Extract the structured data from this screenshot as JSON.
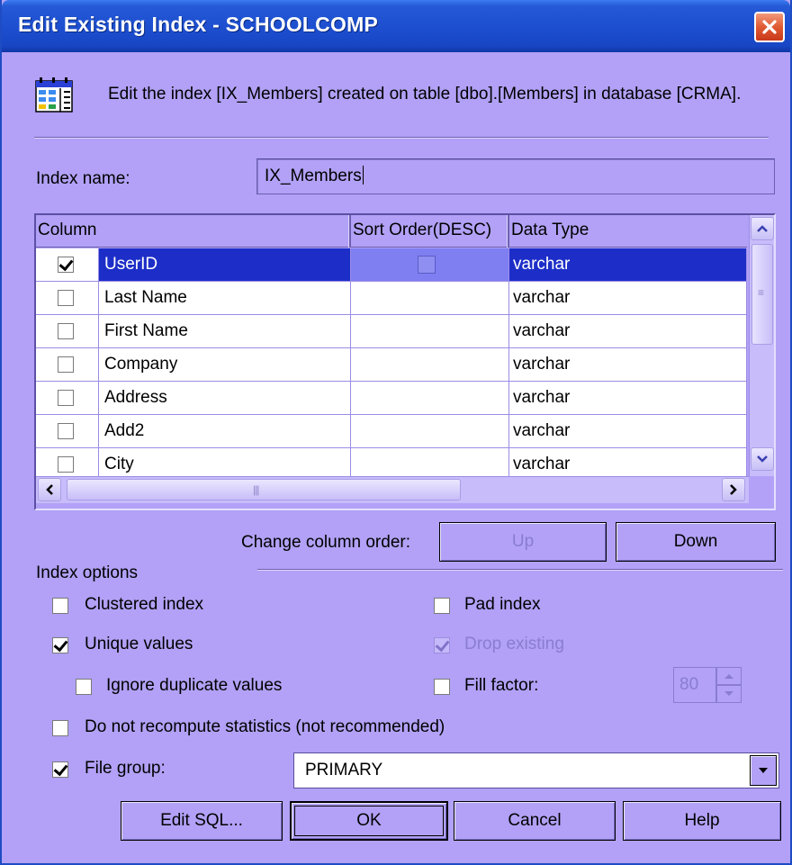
{
  "window": {
    "title": "Edit Existing Index - SCHOOLCOMP"
  },
  "description": "Edit the index [IX_Members] created on table [dbo].[Members] in database [CRMA].",
  "index_name": {
    "label": "Index name:",
    "value": "IX_Members"
  },
  "grid": {
    "headers": {
      "column": "Column",
      "sort_order": "Sort Order(DESC)",
      "data_type": "Data Type"
    },
    "rows": [
      {
        "checked": true,
        "name": "UserID",
        "data_type": "varchar",
        "selected": true
      },
      {
        "checked": false,
        "name": "Last Name",
        "data_type": "varchar",
        "selected": false
      },
      {
        "checked": false,
        "name": "First Name",
        "data_type": "varchar",
        "selected": false
      },
      {
        "checked": false,
        "name": "Company",
        "data_type": "varchar",
        "selected": false
      },
      {
        "checked": false,
        "name": "Address",
        "data_type": "varchar",
        "selected": false
      },
      {
        "checked": false,
        "name": "Add2",
        "data_type": "varchar",
        "selected": false
      },
      {
        "checked": false,
        "name": "City",
        "data_type": "varchar",
        "selected": false
      }
    ]
  },
  "column_order": {
    "label": "Change column order:",
    "up": "Up",
    "down": "Down"
  },
  "options": {
    "group_label": "Index options",
    "clustered": {
      "label": "Clustered index",
      "checked": false
    },
    "unique": {
      "label": "Unique values",
      "checked": true
    },
    "ignore_dup": {
      "label": "Ignore duplicate values",
      "checked": false
    },
    "no_recompute": {
      "label": "Do not recompute statistics (not recommended)",
      "checked": false
    },
    "pad_index": {
      "label": "Pad index",
      "checked": false
    },
    "drop_existing": {
      "label": "Drop existing",
      "checked": true,
      "enabled": false
    },
    "fill_factor": {
      "label": "Fill factor:",
      "checked": false,
      "value": "80"
    },
    "file_group": {
      "label": "File group:",
      "checked": true,
      "value": "PRIMARY"
    }
  },
  "buttons": {
    "edit_sql": "Edit SQL...",
    "ok": "OK",
    "cancel": "Cancel",
    "help": "Help"
  },
  "colors": {
    "dialog_bg": "#b2a1f6",
    "titlebar": "#1d4fd0",
    "selection": "#1d2ec8",
    "close_button": "#e05a32"
  }
}
